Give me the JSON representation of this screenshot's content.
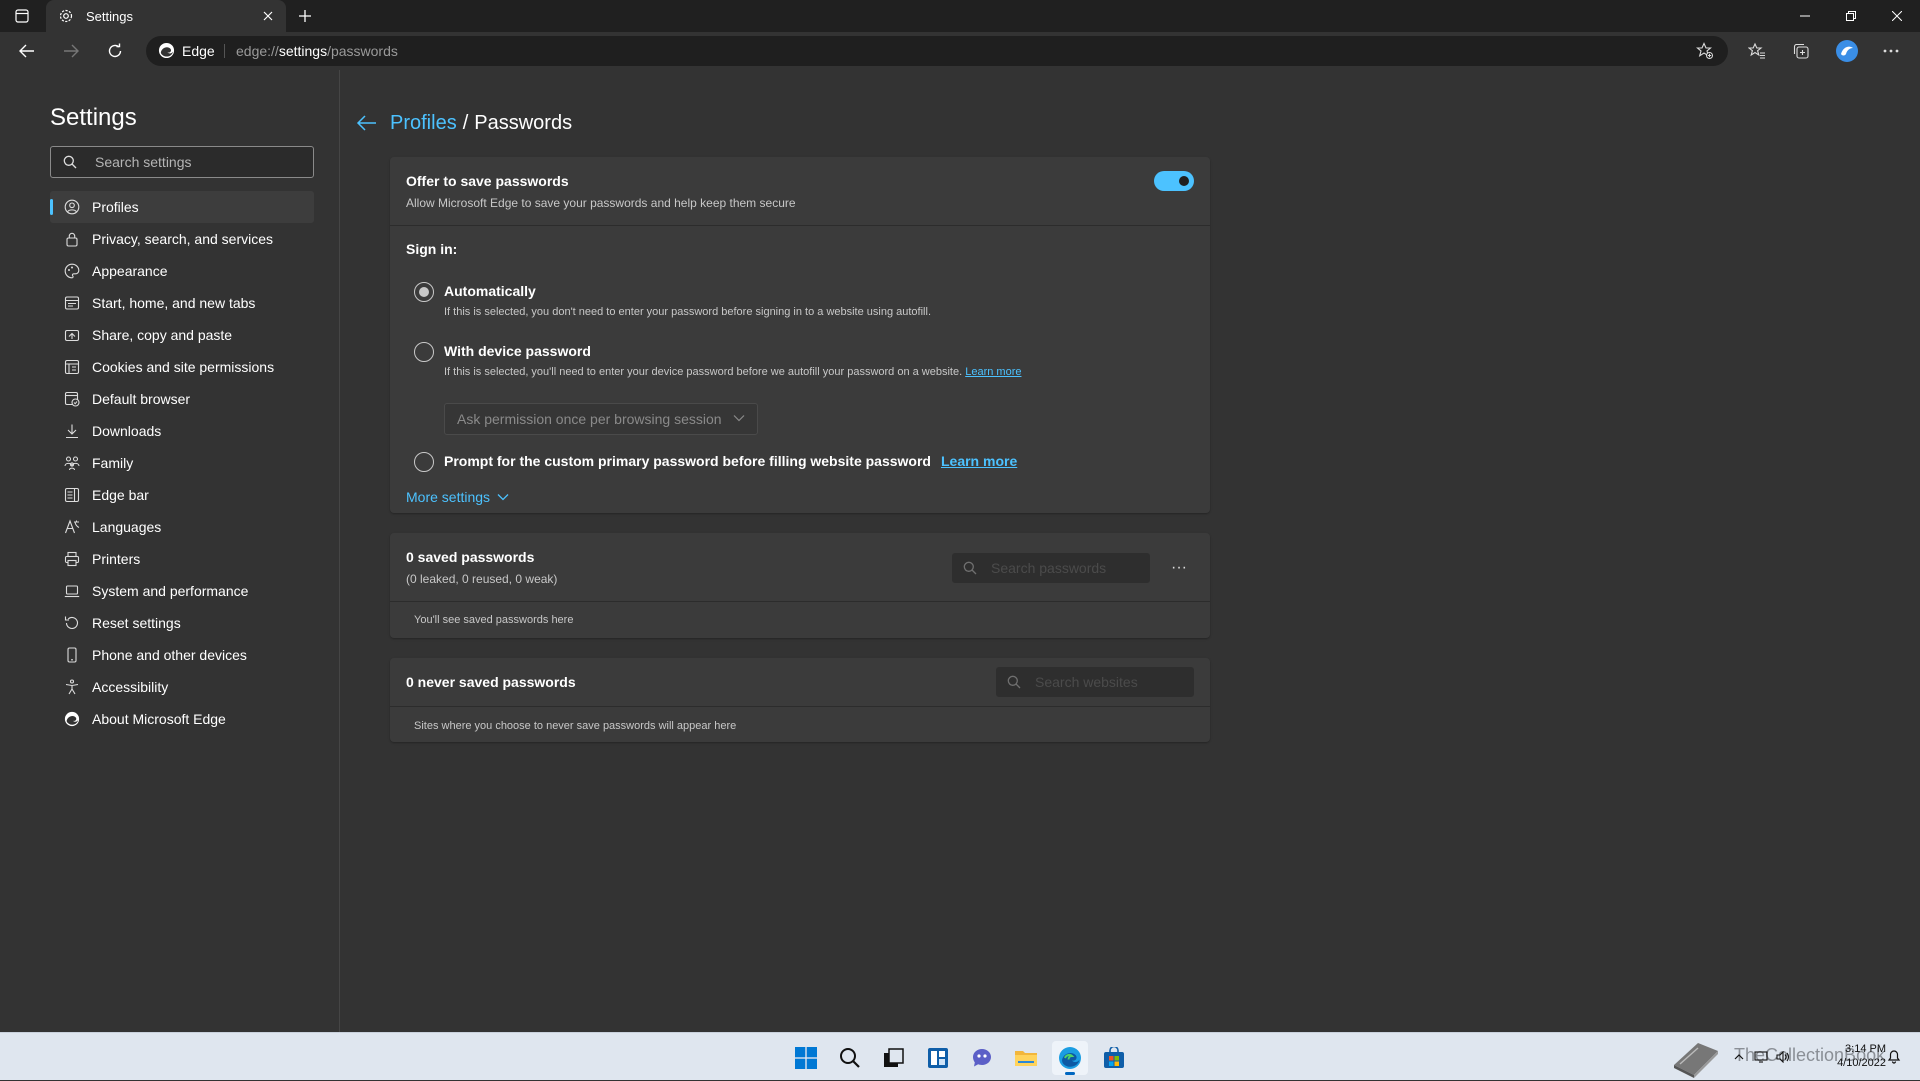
{
  "browser": {
    "tab_title": "Settings",
    "address_brand": "Edge",
    "url_prefix": "edge://",
    "url_bold": "settings",
    "url_suffix": "/passwords"
  },
  "sidebar": {
    "title": "Settings",
    "search_placeholder": "Search settings",
    "items": [
      {
        "label": "Profiles",
        "icon": "profile-icon",
        "active": true
      },
      {
        "label": "Privacy, search, and services",
        "icon": "lock-icon"
      },
      {
        "label": "Appearance",
        "icon": "palette-icon"
      },
      {
        "label": "Start, home, and new tabs",
        "icon": "home-tabs-icon"
      },
      {
        "label": "Share, copy and paste",
        "icon": "share-icon"
      },
      {
        "label": "Cookies and site permissions",
        "icon": "cookies-icon"
      },
      {
        "label": "Default browser",
        "icon": "default-browser-icon"
      },
      {
        "label": "Downloads",
        "icon": "download-icon"
      },
      {
        "label": "Family",
        "icon": "family-icon"
      },
      {
        "label": "Edge bar",
        "icon": "edge-bar-icon"
      },
      {
        "label": "Languages",
        "icon": "languages-icon"
      },
      {
        "label": "Printers",
        "icon": "printer-icon"
      },
      {
        "label": "System and performance",
        "icon": "laptop-icon"
      },
      {
        "label": "Reset settings",
        "icon": "reset-icon"
      },
      {
        "label": "Phone and other devices",
        "icon": "phone-icon"
      },
      {
        "label": "Accessibility",
        "icon": "accessibility-icon"
      },
      {
        "label": "About Microsoft Edge",
        "icon": "edge-logo-icon"
      }
    ]
  },
  "breadcrumb": {
    "parent": "Profiles",
    "separator": "/",
    "current": "Passwords"
  },
  "offer": {
    "title": "Offer to save passwords",
    "description": "Allow Microsoft Edge to save your passwords and help keep them secure",
    "enabled": true
  },
  "signin": {
    "label": "Sign in:",
    "options": [
      {
        "title": "Automatically",
        "description": "If this is selected, you don't need to enter your password before signing in to a website using autofill.",
        "checked": true
      },
      {
        "title": "With device password",
        "description": "If this is selected, you'll need to enter your device password before we autofill your password on a website.",
        "link": "Learn more"
      },
      {
        "title": "Prompt for the custom primary password before filling website password",
        "link": "Learn more"
      }
    ],
    "device_password_select": "Ask permission once per browsing session",
    "more_settings": "More settings"
  },
  "saved": {
    "title": "0 saved passwords",
    "stats": "(0 leaked, 0 reused, 0 weak)",
    "search_placeholder": "Search passwords",
    "empty": "You'll see saved passwords here",
    "more": "···"
  },
  "never_saved": {
    "title": "0 never saved passwords",
    "search_placeholder": "Search websites",
    "empty": "Sites where you choose to never save passwords will appear here"
  },
  "taskbar": {
    "time": "3:14 PM",
    "date": "4/10/2022",
    "watermark": "TheCollectionBook"
  },
  "colors": {
    "accent": "#4cc2ff",
    "background": "#333333",
    "card": "#3b3b3b",
    "taskbar": "#dfe6ef"
  }
}
